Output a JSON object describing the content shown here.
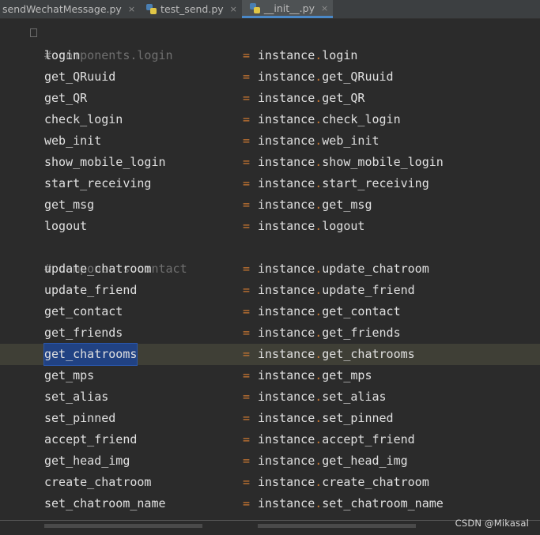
{
  "tabs": [
    {
      "label": "sendWechatMessage.py",
      "icon": "python-file-icon",
      "active": false
    },
    {
      "label": "test_send.py",
      "icon": "python-file-icon",
      "active": false
    },
    {
      "label": "__init__.py",
      "icon": "python-file-icon",
      "active": true
    }
  ],
  "close_glyph": "×",
  "colors": {
    "background": "#2b2b2b",
    "operator": "#cc7832",
    "comment": "#707070",
    "selection": "#214283",
    "current_line": "#3f3f36",
    "active_tab_underline": "#4a88c7"
  },
  "code": {
    "comment_login": "# components.login",
    "comment_contact": "# components.contact",
    "eq": "=",
    "instance": "instance",
    "dot": ".",
    "assignments": [
      {
        "name": "login",
        "attr": "login"
      },
      {
        "name": "get_QRuuid",
        "attr": "get_QRuuid"
      },
      {
        "name": "get_QR",
        "attr": "get_QR"
      },
      {
        "name": "check_login",
        "attr": "check_login"
      },
      {
        "name": "web_init",
        "attr": "web_init"
      },
      {
        "name": "show_mobile_login",
        "attr": "show_mobile_login"
      },
      {
        "name": "start_receiving",
        "attr": "start_receiving"
      },
      {
        "name": "get_msg",
        "attr": "get_msg"
      },
      {
        "name": "logout",
        "attr": "logout"
      },
      {
        "name": "update_chatroom",
        "attr": "update_chatroom"
      },
      {
        "name": "update_friend",
        "attr": "update_friend"
      },
      {
        "name": "get_contact",
        "attr": "get_contact"
      },
      {
        "name": "get_friends",
        "attr": "get_friends"
      },
      {
        "name": "get_chatrooms",
        "attr": "get_chatrooms"
      },
      {
        "name": "get_mps",
        "attr": "get_mps"
      },
      {
        "name": "set_alias",
        "attr": "set_alias"
      },
      {
        "name": "set_pinned",
        "attr": "set_pinned"
      },
      {
        "name": "accept_friend",
        "attr": "accept_friend"
      },
      {
        "name": "get_head_img",
        "attr": "get_head_img"
      },
      {
        "name": "create_chatroom",
        "attr": "create_chatroom"
      },
      {
        "name": "set_chatroom_name",
        "attr": "set_chatroom_name"
      }
    ]
  },
  "watermark": "CSDN @Mikasal"
}
